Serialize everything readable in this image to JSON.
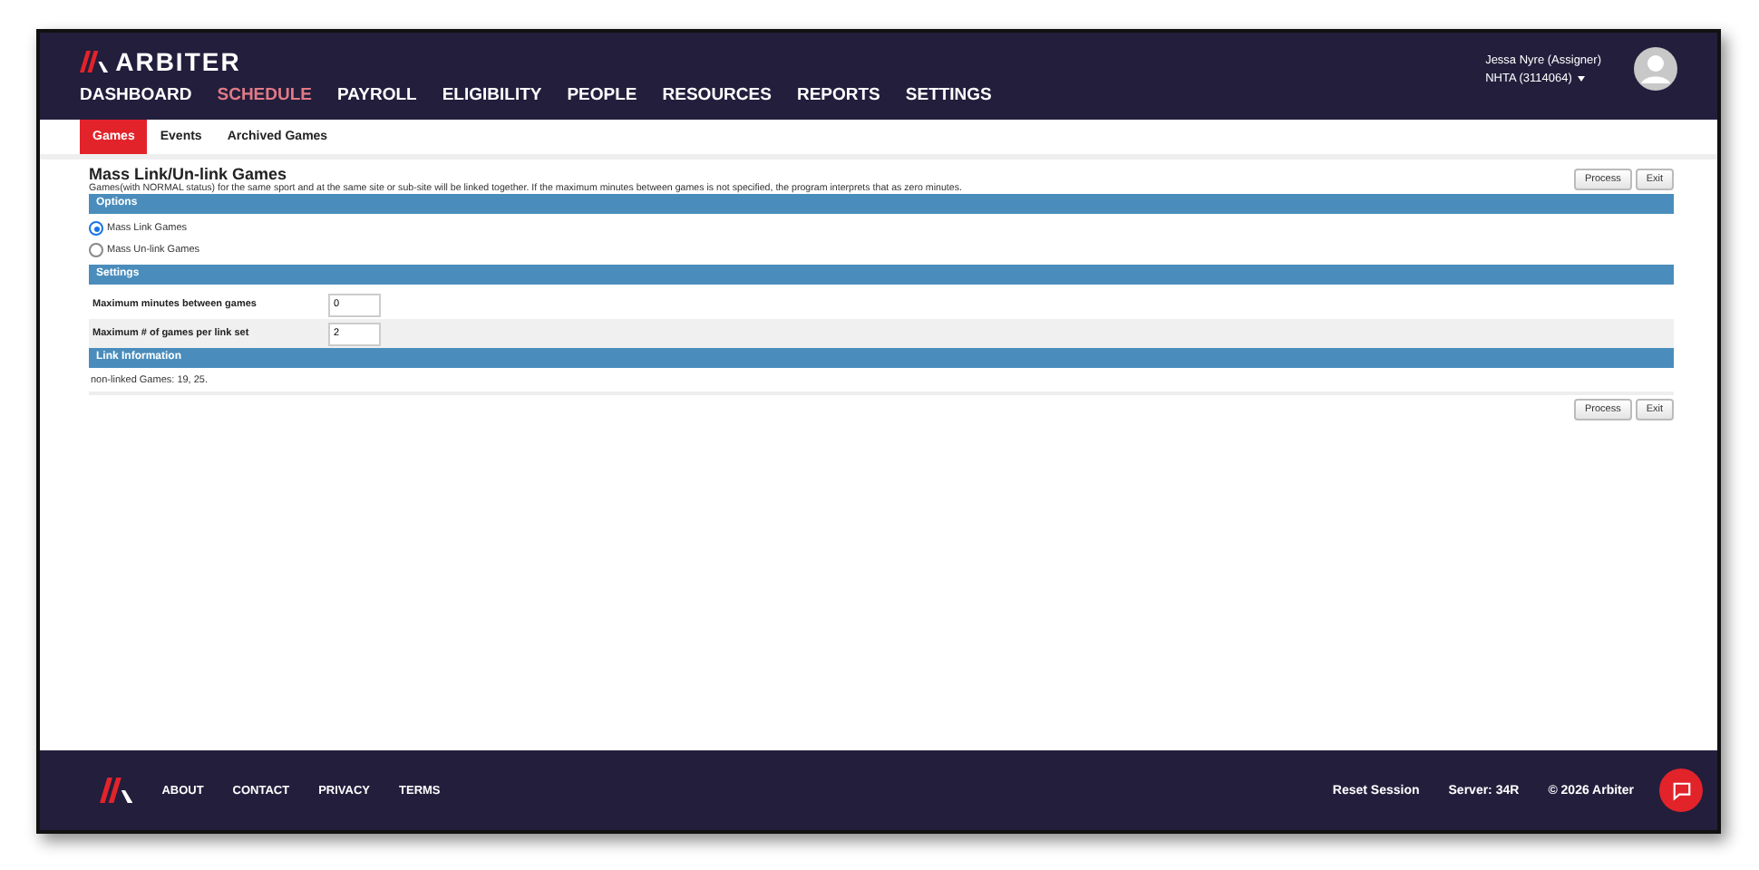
{
  "brand": {
    "name": "ARBITER"
  },
  "nav": [
    {
      "label": "DASHBOARD",
      "selected": false
    },
    {
      "label": "SCHEDULE",
      "selected": true
    },
    {
      "label": "PAYROLL",
      "selected": false
    },
    {
      "label": "ELIGIBILITY",
      "selected": false
    },
    {
      "label": "PEOPLE",
      "selected": false
    },
    {
      "label": "RESOURCES",
      "selected": false
    },
    {
      "label": "REPORTS",
      "selected": false
    },
    {
      "label": "SETTINGS",
      "selected": false
    }
  ],
  "user": {
    "name": "Jessa Nyre (Assigner)",
    "account": "NHTA (3114064)"
  },
  "subtabs": [
    {
      "label": "Games",
      "selected": true
    },
    {
      "label": "Events",
      "selected": false
    },
    {
      "label": "Archived Games",
      "selected": false
    }
  ],
  "page": {
    "title": "Mass Link/Un-link Games",
    "description": "Games(with NORMAL status) for the same sport and at the same site or sub-site will be linked together. If the maximum minutes between games is not specified, the program interprets that as zero minutes.",
    "buttons": [
      "Process",
      "Exit"
    ]
  },
  "options": {
    "heading": "Options",
    "radios": [
      {
        "label": "Mass Link Games",
        "selected": true
      },
      {
        "label": "Mass Un-link Games",
        "selected": false
      }
    ]
  },
  "settings": {
    "heading": "Settings",
    "fields": [
      {
        "label": "Maximum minutes between games",
        "value": "0"
      },
      {
        "label": "Maximum # of games per link set",
        "value": "2"
      }
    ]
  },
  "link_information": {
    "heading": "Link Information",
    "text": "non-linked Games: 19, 25."
  },
  "bottom_buttons": [
    "Process",
    "Exit"
  ],
  "footer": {
    "links": [
      "ABOUT",
      "CONTACT",
      "PRIVACY",
      "TERMS"
    ],
    "reset": "Reset Session",
    "server": "Server: 34R",
    "copyright": "© 2026 Arbiter"
  }
}
